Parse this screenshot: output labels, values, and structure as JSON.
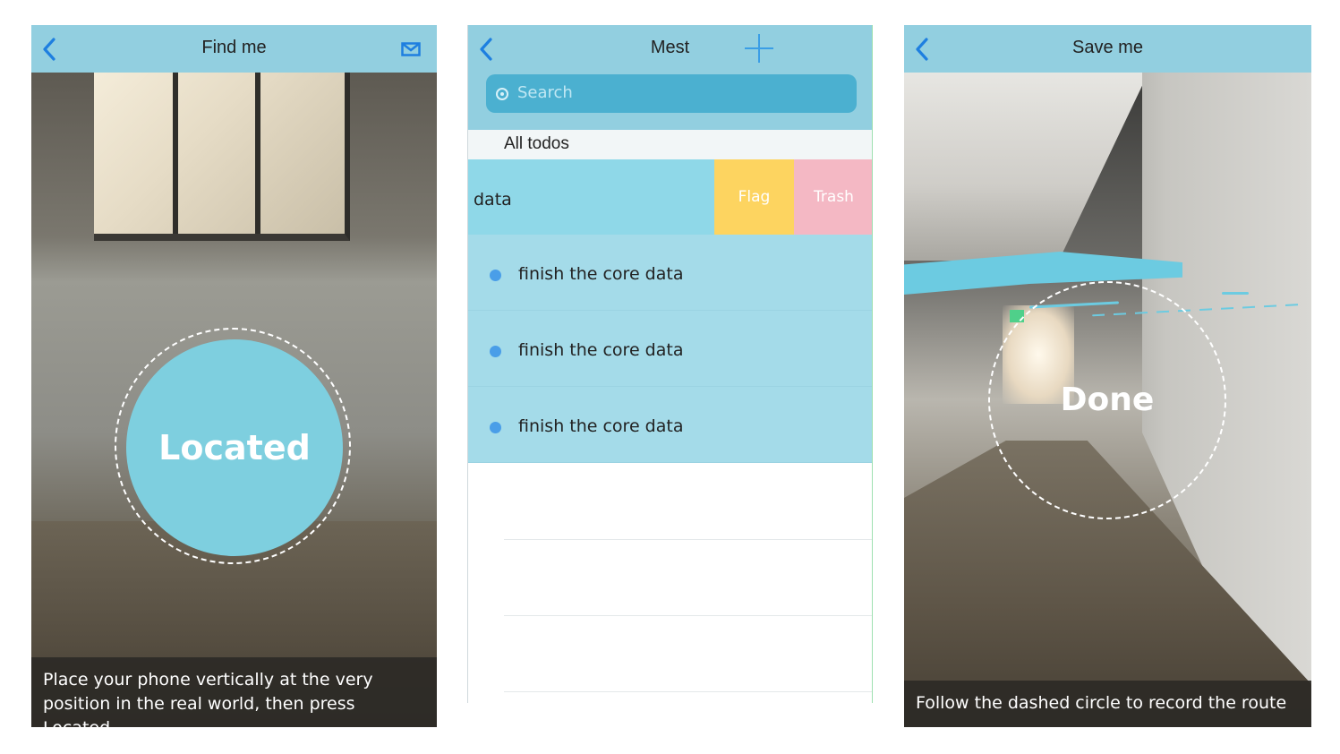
{
  "find_me": {
    "title": "Find me",
    "back_icon": "chevron-left-icon",
    "mail_icon": "mail-icon",
    "located_label": "Located",
    "caption_line1": "Place your phone vertically at the very",
    "caption_line2": "position in the real world, then press Located"
  },
  "todos": {
    "title": "Mest",
    "back_icon": "chevron-left-icon",
    "add_icon": "plus-icon",
    "search_placeholder": "Search",
    "section_title": "All todos",
    "swiped_item": {
      "text": "data",
      "flag_label": "Flag",
      "trash_label": "Trash"
    },
    "items": [
      {
        "text": "finish the core data"
      },
      {
        "text": "finish the core data"
      },
      {
        "text": "finish the core data"
      }
    ]
  },
  "save_me": {
    "title": "Save me",
    "back_icon": "chevron-left-icon",
    "done_label": "Done",
    "caption": "Follow the dashed circle to record the route"
  },
  "colors": {
    "nav_bar": "#92cfe0",
    "accent_blue": "#1e7fe0",
    "located_circle": "#7ecfdf",
    "flag": "#fdd460",
    "trash": "#f4b8c4",
    "todo_row": "#a4dbe9",
    "search_box": "#4bb0d0"
  }
}
